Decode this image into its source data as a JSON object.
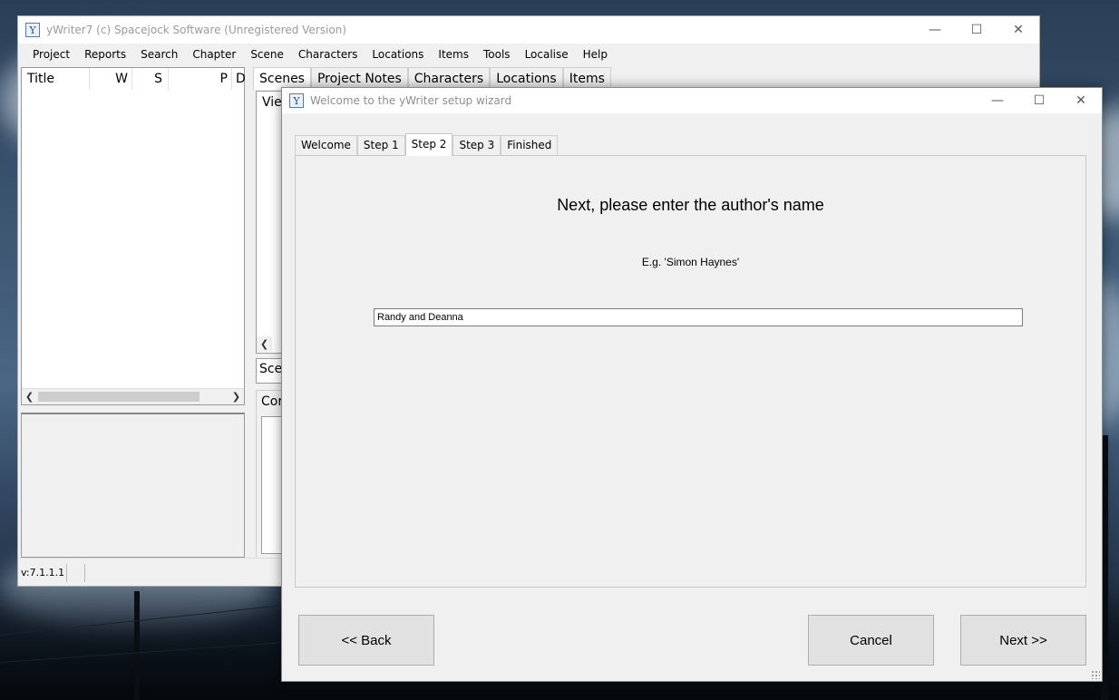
{
  "main_window": {
    "title": "yWriter7 (c) Spacejock Software (Unregistered Version)",
    "app_icon_glyph": "Y",
    "menu": [
      "Project",
      "Reports",
      "Search",
      "Chapter",
      "Scene",
      "Characters",
      "Locations",
      "Items",
      "Tools",
      "Localise",
      "Help"
    ],
    "chapter_list_columns": [
      "Title",
      "W",
      "S",
      "P",
      "D"
    ],
    "tabs": [
      "Scenes",
      "Project Notes",
      "Characters",
      "Locations",
      "Items"
    ],
    "active_tab": "Scenes",
    "partial_labels": {
      "view": "Vie",
      "scene": "Sce",
      "content": "Cor"
    },
    "status_version": "v:7.1.1.1"
  },
  "wizard": {
    "title": "Welcome to the yWriter setup wizard",
    "tabs": [
      "Welcome",
      "Step 1",
      "Step 2",
      "Step 3",
      "Finished"
    ],
    "active_tab": "Step 2",
    "heading": "Next, please enter the author's name",
    "example": "E.g. 'Simon Haynes'",
    "author_value": "Randy and Deanna",
    "buttons": {
      "back": "<< Back",
      "cancel": "Cancel",
      "next": "Next >>"
    }
  },
  "window_controls": {
    "minimize": "—",
    "maximize": "☐",
    "close": "✕"
  },
  "colors": {
    "dialog_bg": "#f0f0f0",
    "titlebar_bg": "#ffffff",
    "button_bg": "#e1e1e1"
  }
}
